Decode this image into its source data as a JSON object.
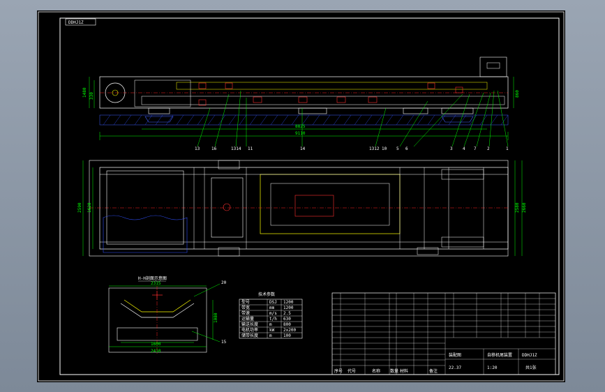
{
  "sheet": {
    "drawing_code": "DDHJ1Z",
    "colors": {
      "background": "#000000",
      "frame": "#ffffff",
      "structure": "#ffffff",
      "dimension": "#00ff00",
      "center": "#ff0000",
      "highlight": "#ffff00",
      "hatch": "#0000ff",
      "text": "#ffffff"
    }
  },
  "elevation_view": {
    "overall_length": "9110",
    "sub_length": "8825",
    "height_left": "1480",
    "height_right": "860",
    "height_small": "330",
    "part_labels": [
      "13",
      "16",
      "1314",
      "11",
      "14",
      "1312",
      "10",
      "5",
      "6",
      "3",
      "4",
      "7",
      "2",
      "1"
    ]
  },
  "plan_view": {
    "width_left": "2590",
    "width_inner": "1620",
    "width_right": "2580",
    "width_right_2": "2660"
  },
  "section_view": {
    "title": "H-H剖面示意图",
    "top_width": "2315",
    "bottom_width": "2410",
    "inner_width": "1600",
    "height": "1080",
    "label_top": "20",
    "label_right": "15"
  },
  "spec_table": {
    "title": "技术参数",
    "rows": [
      [
        "型号",
        "DSJ",
        "1200"
      ],
      [
        "带宽",
        "mm",
        "1200"
      ],
      [
        "带速",
        "m/s",
        "2.5"
      ],
      [
        "运输量",
        "t/h",
        "630"
      ],
      [
        "输送长度",
        "m",
        "800"
      ],
      [
        "电机功率",
        "kW",
        "2x200"
      ],
      [
        "储带长度",
        "m",
        "100"
      ]
    ]
  },
  "title_block": {
    "drawing_title": "自移机尾装置",
    "drawing_number": "DDHJ1Z",
    "sheet_mark": "装配图",
    "scale": "1:20",
    "weight": "22.37",
    "sheet": "共1张",
    "headers": [
      "序号",
      "代号",
      "名称",
      "数量",
      "材料",
      "备注"
    ]
  }
}
